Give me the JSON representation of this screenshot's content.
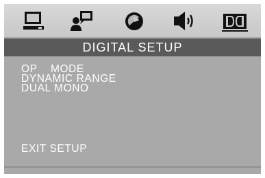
{
  "tabs": [
    {
      "icon": "tv-monitor-icon"
    },
    {
      "icon": "speaking-person-icon"
    },
    {
      "icon": "contrast-circle-icon"
    },
    {
      "icon": "speaker-icon"
    },
    {
      "icon": "dolby-icon",
      "selected": true
    }
  ],
  "header": {
    "title": "DIGITAL SETUP"
  },
  "menu": {
    "items": [
      {
        "label": "OP    MODE"
      },
      {
        "label": "DYNAMIC RANGE"
      },
      {
        "label": "DUAL MONO"
      }
    ],
    "exit_label": "EXIT SETUP"
  },
  "colors": {
    "screen_bg": "#a9a9a9",
    "titlebar_bg": "#5a5a5a",
    "text": "#ffffff",
    "icon": "#111111"
  }
}
